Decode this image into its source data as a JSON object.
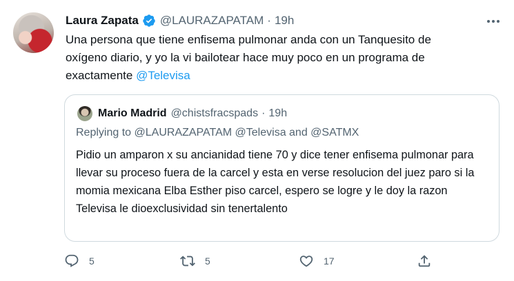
{
  "tweet": {
    "author_name": "Laura Zapata",
    "author_handle": "@LAURAZAPATAM",
    "separator": "·",
    "time": "19h",
    "text_line1": "Una persona que tiene enfisema pulmonar anda con un Tanquesito de",
    "text_line2": "oxígeno diario,  y yo la vi bailotear hace muy poco en un programa de",
    "text_line3_prefix": "exactamente ",
    "text_mention": "@Televisa"
  },
  "quote": {
    "author_name": "Mario Madrid",
    "author_handle": "@chistsfracspads",
    "separator": "·",
    "time": "19h",
    "replying_prefix": "Replying to ",
    "replying_mentions": "@LAURAZAPATAM @Televisa and @SATMX",
    "text": "Pidio un amparon x su ancianidad tiene 70 y dice tener enfisema pulmonar para llevar su proceso fuera de la carcel y esta en verse resolucion del juez paro si la momia mexicana Elba Esther piso carcel, espero se logre y le doy la razon Televisa le dioexclusividad sin tenertalento"
  },
  "actions": {
    "reply_count": "5",
    "retweet_count": "5",
    "like_count": "17",
    "icons": [
      "reply-icon",
      "retweet-icon",
      "like-icon",
      "share-icon"
    ]
  },
  "colors": {
    "link": "#1d9bf0",
    "secondary": "#536471",
    "border": "#cfd9de"
  }
}
